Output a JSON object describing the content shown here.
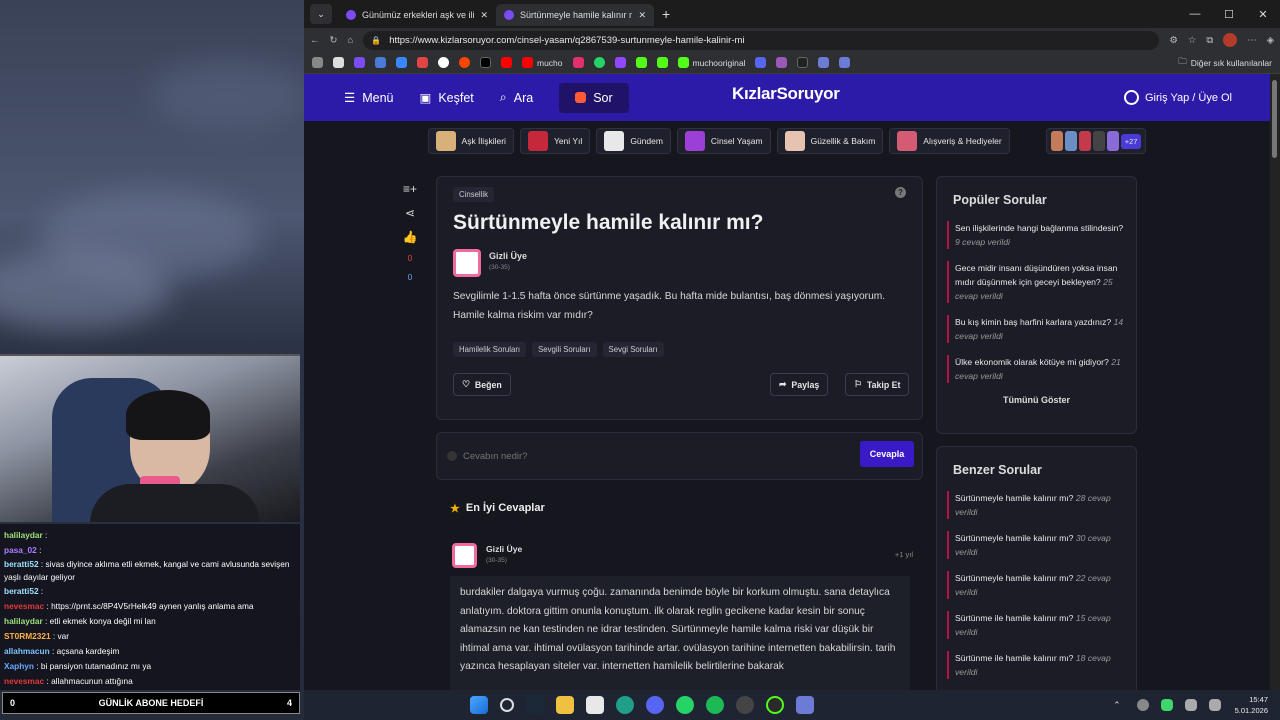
{
  "tabs": [
    {
      "title": "Günümüz erkekleri aşk ve ilişki kon"
    },
    {
      "title": "Sürtünmeyle hamile kalınır mı? - K"
    }
  ],
  "address": {
    "url": "https://www.kizlarsoruyor.com/cinsel-yasam/q2867539-surtunmeyle-hamile-kalinir-mi"
  },
  "bookmarks": {
    "mucho": "mucho",
    "muchooriginal": "muchooriginal",
    "other": "Diğer sık kullanılanlar"
  },
  "header": {
    "menu": "Menü",
    "discover": "Keşfet",
    "search": "Ara",
    "ask": "Sor",
    "logo": "KızlarSoruyor",
    "login": "Giriş Yap / Üye Ol"
  },
  "categories": [
    {
      "label": "Aşk İlişkileri",
      "color": "#d8b07a"
    },
    {
      "label": "Yeni Yıl",
      "color": "#c4283a"
    },
    {
      "label": "Gündem",
      "color": "#e8e8e8"
    },
    {
      "label": "Cinsel Yaşam",
      "color": "#9b3fd6"
    },
    {
      "label": "Güzellik & Bakım",
      "color": "#e6c2b0"
    },
    {
      "label": "Alışveriş & Hediyeler",
      "color": "#d35b74"
    }
  ],
  "more_count": "+27",
  "side": {
    "down": "0",
    "up": "0"
  },
  "question": {
    "category": "Cinsellik",
    "help": "?",
    "title": "Sürtünmeyle hamile kalınır mı?",
    "user": "Gizli Üye",
    "age": "(30-35)",
    "body": "Sevgilimle 1-1.5 hafta önce sürtünme yaşadık. Bu hafta mide bulantısı, baş dönmesi yaşıyorum. Hamile kalma riskim var mıdır?",
    "tags": [
      "Hamilelik Soruları",
      "Sevgili Soruları",
      "Sevgi Soruları"
    ],
    "like": "Beğen",
    "share": "Paylaş",
    "follow": "Takip Et"
  },
  "answer_box": {
    "placeholder": "Cevabın nedir?",
    "submit": "Cevapla"
  },
  "best": {
    "heading": "En İyi Cevaplar",
    "user": "Gizli Üye",
    "age": "(30-35)",
    "time": "+1 yıl",
    "text": "burdakiler dalgaya vurmuş çoğu. zamanında benimde böyle bir korkum olmuştu. sana detaylıca anlatıyım. doktora gittim onunla konuştum. ilk olarak reglin gecikene kadar kesin bir sonuç alamazsın ne kan testinden ne idrar testinden. Sürtünmeyle hamile kalma riski var düşük bir ihtimal ama var. ihtimal ovülasyon tarihinde artar. ovülasyon tarihine internetten bakabilirsin. tarih yazınca hesaplayan siteler var. internetten hamilelik belirtilerine bakarak"
  },
  "popular": {
    "heading": "Popüler Sorular",
    "items": [
      {
        "q": "Sen ilişkilerinde hangi bağlanma stilindesin?",
        "n": "9 cevap verildi"
      },
      {
        "q": "Gece midir insanı düşündüren yoksa insan mıdır düşünmek için geceyi bekleyen?",
        "n": "25 cevap verildi"
      },
      {
        "q": "Bu kış kimin baş harfini karlara yazdınız?",
        "n": "14 cevap verildi"
      },
      {
        "q": "Ülke ekonomik olarak kötüye mi gidiyor?",
        "n": "21 cevap verildi"
      }
    ],
    "show_all": "Tümünü Göster"
  },
  "similar": {
    "heading": "Benzer Sorular",
    "items": [
      {
        "q": "Sürtünmeyle hamile kalınır mı?",
        "n": "28 cevap verildi"
      },
      {
        "q": "Sürtünmeyle hamile kalınır mı?",
        "n": "30 cevap verildi"
      },
      {
        "q": "Sürtünmeyle hamile kalınır mı?",
        "n": "22 cevap verildi"
      },
      {
        "q": "Sürtünme ile hamile kalınır mı?",
        "n": "15 cevap verildi"
      },
      {
        "q": "Sürtünme ile hamile kalınır mı?",
        "n": "18 cevap verildi"
      }
    ]
  },
  "chat": [
    {
      "name": "halilaydar",
      "msg": "",
      "color": "#9ee07a"
    },
    {
      "name": "pasa_02",
      "msg": "",
      "color": "#b07cff"
    },
    {
      "name": "beratti52",
      "msg": "sivas diyince aklıma etli ekmek, kangal ve cami avlusunda sevişen yaşlı dayılar geliyor",
      "color": "#9ee0ff"
    },
    {
      "name": "beratti52",
      "msg": "",
      "color": "#9ee0ff"
    },
    {
      "name": "nevesmac",
      "msg": "https://prnt.sc/8P4V5rHelk49 aynen yanlış anlama ama",
      "color": "#e03a3a"
    },
    {
      "name": "halilaydar",
      "msg": "etli ekmek konya değil mi lan",
      "color": "#9ee07a"
    },
    {
      "name": "ST0RM2321",
      "msg": "var",
      "color": "#ffb347"
    },
    {
      "name": "allahmacun",
      "msg": "açsana kardeşim",
      "color": "#7cc4ff"
    },
    {
      "name": "Xaphyn",
      "msg": "bi pansiyon tutamadınız mı ya",
      "color": "#6aa8ff"
    },
    {
      "name": "nevesmac",
      "msg": "allahmacunun attığına",
      "color": "#e03a3a"
    }
  ],
  "goal": {
    "left": "0",
    "label": "GÜNLİK ABONE HEDEFİ",
    "right": "4"
  },
  "clock": {
    "time": "15:47",
    "date": "5.01.2026"
  }
}
